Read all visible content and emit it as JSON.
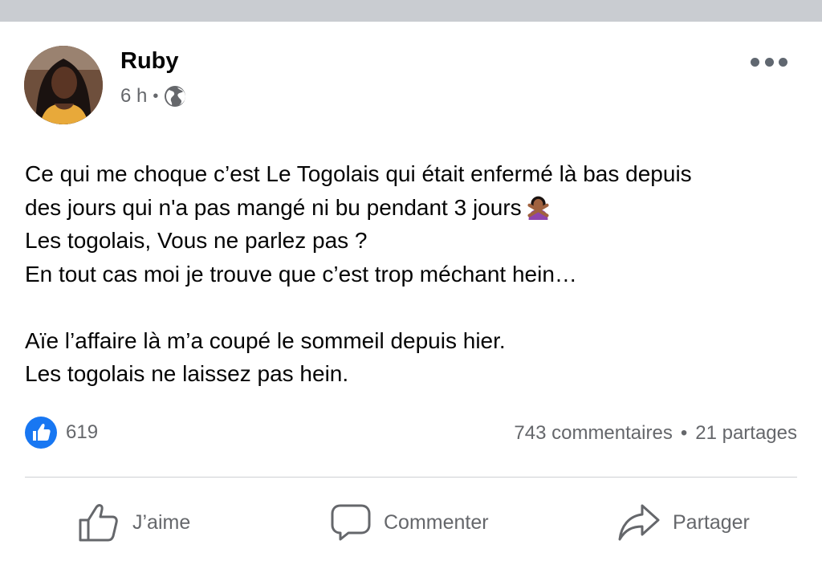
{
  "post": {
    "author": "Ruby",
    "time": "6 h",
    "separator": "•",
    "privacy_icon": "globe-icon",
    "more_icon": "more-dots-icon",
    "lines": [
      "Ce qui me choque c’est Le Togolais qui était enfermé là bas depuis",
      "des jours qui n'a pas mangé ni bu pendant 3 jours",
      "Les togolais, Vous ne parlez pas ?",
      "En tout cas moi je trouve que c’est trop méchant hein…",
      "",
      "Aïe l’affaire là m’a coupé le sommeil depuis hier.",
      "Les togolais ne laissez pas hein."
    ],
    "emoji": "person-gesturing-no-emoji"
  },
  "stats": {
    "reaction_icon": "like-reaction-icon",
    "likes": "619",
    "comments": "743 commentaires",
    "separator": "•",
    "shares": "21 partages"
  },
  "actions": {
    "like": "J’aime",
    "comment": "Commenter",
    "share": "Partager"
  },
  "colors": {
    "accent": "#1877f2",
    "secondary_text": "#65676b",
    "top_bar": "#c9ccd1",
    "divider": "#ced0d4"
  }
}
